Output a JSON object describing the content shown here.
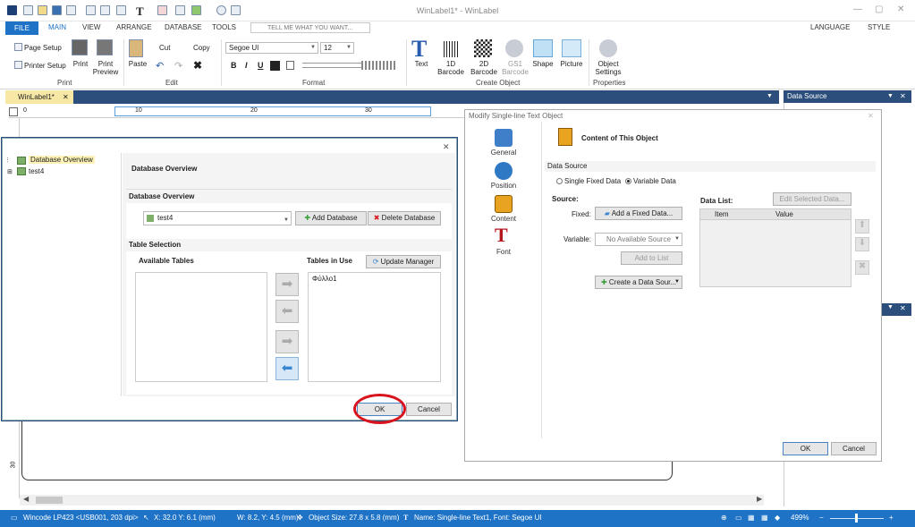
{
  "window": {
    "title": "WinLabel1* - WinLabel",
    "minimize_glyph": "—",
    "maximize_glyph": "▢",
    "close_glyph": "✕"
  },
  "ribbon_tabs": [
    "FILE",
    "MAIN",
    "VIEW",
    "ARRANGE",
    "DATABASE",
    "TOOLS"
  ],
  "tell_me": "TELL ME WHAT YOU WANT...",
  "language": "LANGUAGE",
  "style": "STYLE",
  "ribbon": {
    "page_setup": "Page Setup",
    "printer_setup": "Printer Setup",
    "print": "Print",
    "print_preview": "Print\nPreview",
    "group_print": "Print",
    "paste": "Paste",
    "cut": "Cut",
    "copy": "Copy",
    "group_edit": "Edit",
    "font_name": "Segoe UI",
    "font_size": "12",
    "bold": "B",
    "italic": "I",
    "underline": "U",
    "group_format": "Format",
    "text": "Text",
    "barcode_1d": "1D\nBarcode",
    "barcode_2d": "2D\nBarcode",
    "gs1": "GS1\nBarcode",
    "shape": "Shape",
    "picture": "Picture",
    "group_create": "Create Object",
    "object_settings": "Object\nSettings",
    "group_properties": "Properties"
  },
  "doc_tab": "WinLabel1*",
  "doc_tab_close": "✕",
  "ruler_marks": [
    "0",
    "10",
    "20",
    "30"
  ],
  "vruler_mark": "30",
  "datasource_title": "Data Source",
  "status": {
    "printer": "Wincode LP423 <USB001, 203 dpi>",
    "xy": "X: 32.0  Y: 6.1 (mm)",
    "wh": "W: 8.2, Y: 4.5 (mm)",
    "obj_size": "Object Size: 27.8 x 5.8 (mm)",
    "name": "Name: Single-line Text1, Font: Segoe UI",
    "zoom": "499%",
    "zoom_minus": "−",
    "zoom_plus": "+"
  },
  "modify": {
    "title": "Modify Single-line Text Object",
    "close_glyph": "✕",
    "side": [
      "General",
      "Position",
      "Content",
      "Font"
    ],
    "content_heading": "Content of This Object",
    "data_source": "Data Source",
    "single_fixed": "Single Fixed Data",
    "variable": "Variable Data",
    "source": "Source:",
    "fixed": "Fixed:",
    "add_fixed": "Add a Fixed Data...",
    "variable_lbl": "Variable:",
    "no_source": "No Available Source",
    "add_to_list": "Add to List",
    "create_source": "Create a Data Sour...",
    "data_list": "Data List:",
    "edit_selected": "Edit Selected Data...",
    "col_item": "Item",
    "col_value": "Value",
    "ok": "OK",
    "cancel": "Cancel"
  },
  "db": {
    "close_glyph": "✕",
    "tree": [
      "Database Overview",
      "test4"
    ],
    "header": "Database Overview",
    "section_overview": "Database Overview",
    "db_selected": "test4",
    "add_db": "Add Database",
    "delete_db": "Delete Database",
    "section_table": "Table Selection",
    "available": "Available Tables",
    "in_use": "Tables in Use",
    "update_manager": "Update Manager",
    "table_items": [
      "Φύλλο1"
    ],
    "ok": "OK",
    "cancel": "Cancel"
  },
  "colors": {
    "accent": "#1e73c6",
    "doc_tab_bar": "#2b4e7d",
    "highlight": "#d9141e"
  }
}
